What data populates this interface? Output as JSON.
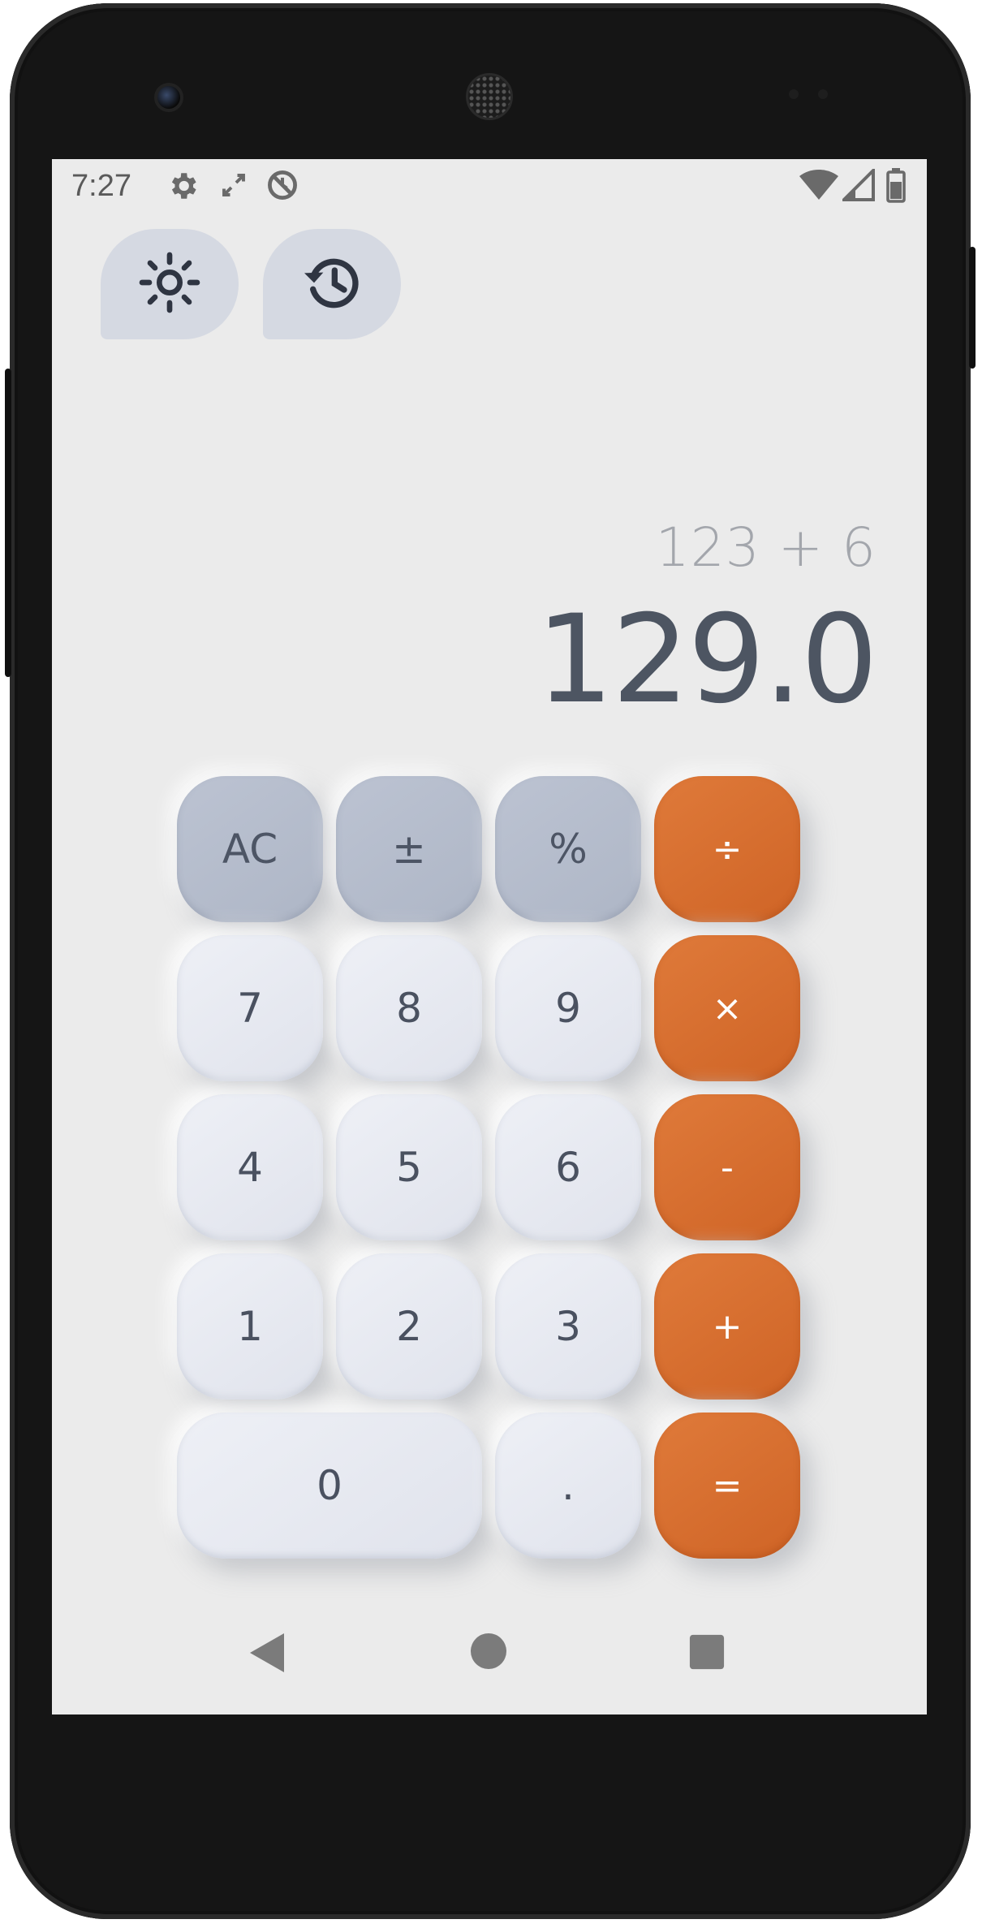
{
  "status_bar": {
    "time": "7:27",
    "left_icons": [
      "gear-icon",
      "rotate-icon",
      "no-sync-icon"
    ],
    "right_icons": [
      "wifi-icon",
      "cellular-icon",
      "battery-icon"
    ]
  },
  "toolbar": {
    "theme_icon": "sun-icon",
    "history_icon": "history-icon"
  },
  "display": {
    "expression": "123 + 6",
    "result": "129.0"
  },
  "keypad": {
    "ac": "AC",
    "plus_minus": "±",
    "percent": "%",
    "divide": "÷",
    "seven": "7",
    "eight": "8",
    "nine": "9",
    "multiply": "×",
    "four": "4",
    "five": "5",
    "six": "6",
    "minus": "-",
    "one": "1",
    "two": "2",
    "three": "3",
    "plus": "+",
    "zero": "0",
    "decimal": ".",
    "equals": "="
  },
  "nav_bar": {
    "back_icon": "back-triangle-icon",
    "home_icon": "home-circle-icon",
    "recents_icon": "recents-square-icon"
  },
  "colors": {
    "background": "#ebebeb",
    "operator": "#d56b2c",
    "function_key": "#b3bacb",
    "number_key": "#e6e9f1",
    "result_text": "#4d5562",
    "expression_text": "#a3a6ac"
  }
}
